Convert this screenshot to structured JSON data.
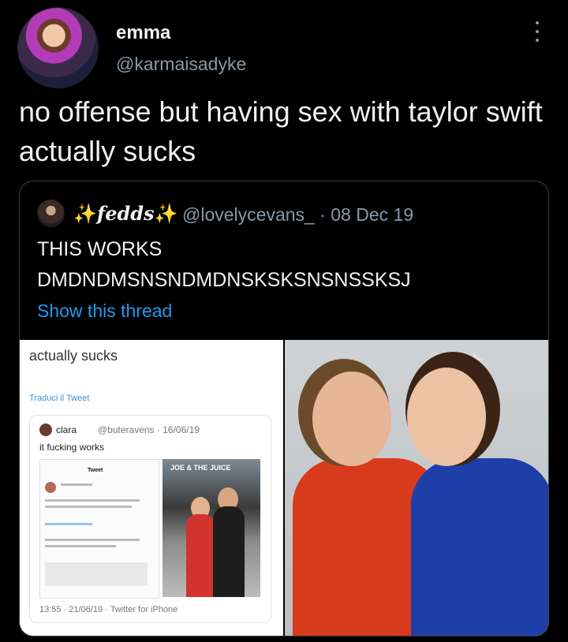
{
  "author": {
    "name": "emma",
    "handle": "@karmaisadyke"
  },
  "tweet": {
    "text": "no offense but having sex with taylor swift actually sucks"
  },
  "quoted": {
    "name": "fedds",
    "sparkle": "✨",
    "handle_date": "@lovelycevans_ · 08 Dec 19",
    "line1": "THIS WORKS",
    "line2": "DMDNDMSNSNDMDNSKSKSNSNSSKSJ",
    "show_thread": "Show this thread"
  },
  "screenshot": {
    "top_text": "actually sucks",
    "translate": "Traduci il Tweet",
    "inner_name": "clara",
    "inner_handle": "@buteravens · 16/06/19",
    "inner_text": "it fucking works",
    "phone_title": "Tweet",
    "footer": "13:55 · 21/06/19 · Twitter for iPhone",
    "photo_sign": "JOE & THE JUICE"
  },
  "colors": {
    "background": "#000000",
    "link": "#1d9bf0",
    "muted": "#8b98a5"
  },
  "icons": [
    "more-vertical-icon"
  ]
}
